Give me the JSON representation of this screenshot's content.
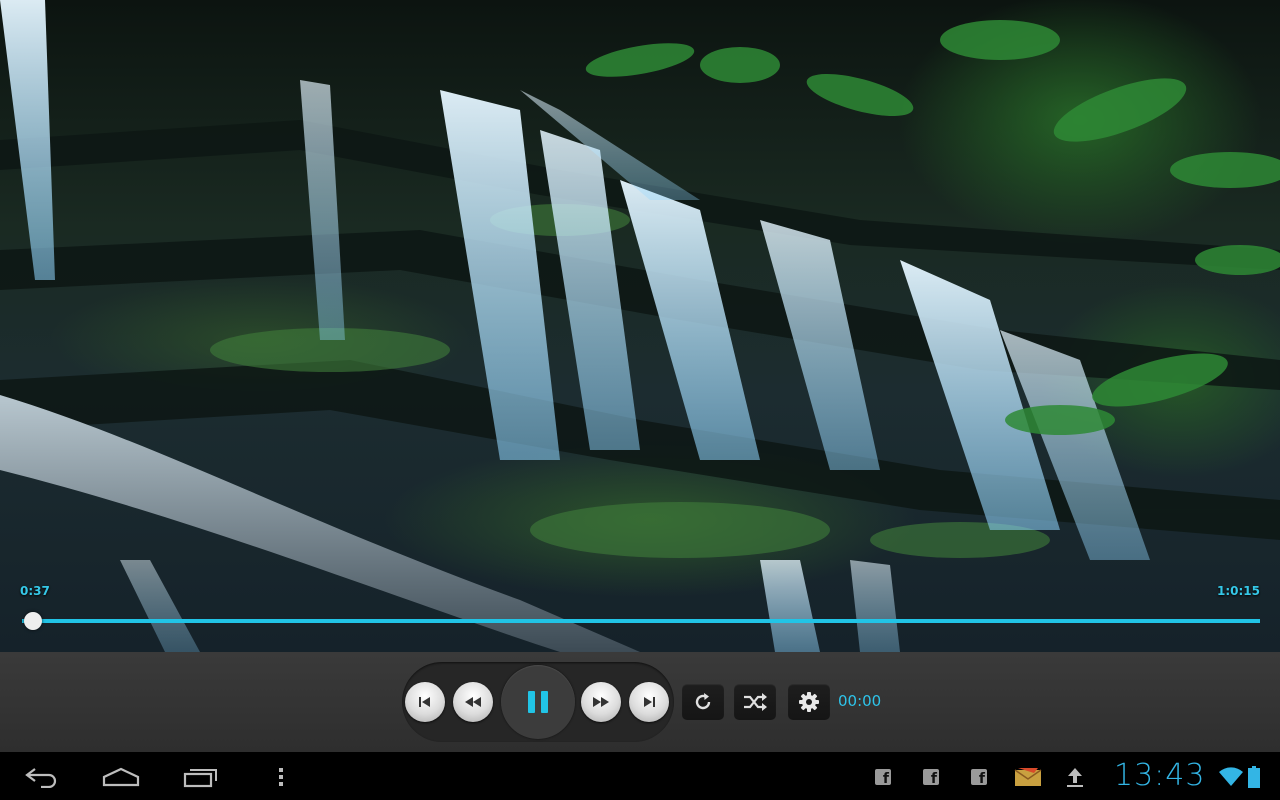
{
  "player": {
    "elapsed": "0:37",
    "duration": "1:0:15",
    "progress_fraction": 0.009,
    "timer_readout": "00:00",
    "buttons": [
      "previous-icon",
      "rewind-icon",
      "pause-icon",
      "fast-forward-icon",
      "next-icon",
      "repeat-icon",
      "shuffle-icon",
      "gear-icon"
    ],
    "accent_color": "#21c4e6"
  },
  "status_bar": {
    "time": "13:43",
    "notifications": [
      "facebook-icon",
      "facebook-icon",
      "facebook-icon",
      "mail-icon",
      "upload-icon"
    ],
    "indicators": [
      "wifi-icon",
      "battery-icon"
    ],
    "accent_color": "#33b5e5"
  },
  "nav_bar": {
    "buttons": [
      "back-icon",
      "home-icon",
      "recent-apps-icon",
      "menu-overflow-icon"
    ]
  }
}
